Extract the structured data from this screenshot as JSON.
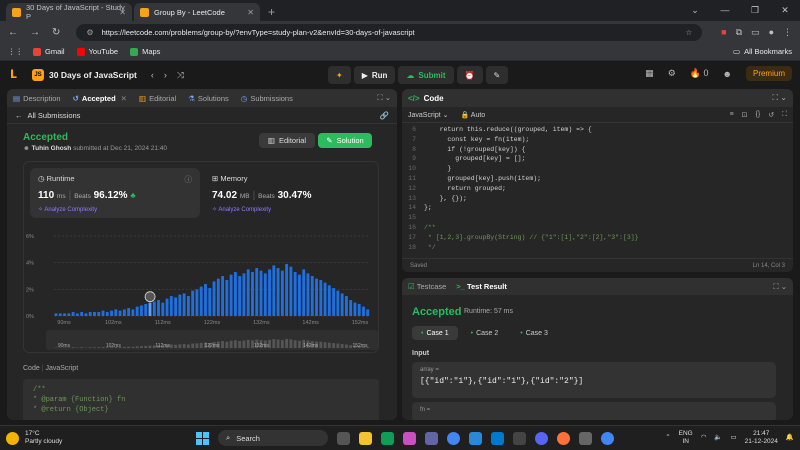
{
  "browser": {
    "tabs": [
      {
        "title": "30 Days of JavaScript - Study P"
      },
      {
        "title": "Group By - LeetCode"
      }
    ],
    "new_tab": "+",
    "url": "https://leetcode.com/problems/group-by/?envType=study-plan-v2&envId=30-days-of-javascript",
    "bookmarks": [
      "Gmail",
      "YouTube",
      "Maps"
    ],
    "all_bookmarks": "All Bookmarks"
  },
  "header": {
    "study_plan": "30 Days of JavaScript",
    "run": "Run",
    "submit": "Submit",
    "streak": "0",
    "premium": "Premium"
  },
  "left": {
    "tabs": [
      "Description",
      "Accepted",
      "Editorial",
      "Solutions",
      "Submissions"
    ],
    "all_submissions": "All Submissions",
    "status": "Accepted",
    "author": "Tuhin Ghosh",
    "submitted": "submitted at Dec 21, 2024 21:40",
    "editorial_btn": "Editorial",
    "solution_btn": "Solution",
    "runtime": {
      "label": "Runtime",
      "value": "110",
      "unit": "ms",
      "beats_label": "Beats",
      "beats": "96.12%",
      "analyze": "Analyze Complexity"
    },
    "memory": {
      "label": "Memory",
      "value": "74.02",
      "unit": "MB",
      "beats_label": "Beats",
      "beats": "30.47%",
      "analyze": "Analyze Complexity"
    },
    "code_header": "Code",
    "code_lang": "JavaScript",
    "code_lines": [
      "/**",
      " * @param {Function} fn",
      " * @return {Object}"
    ]
  },
  "chart_data": {
    "type": "bar",
    "y_ticks": [
      "6%",
      "4%",
      "2%",
      "0%"
    ],
    "ylim": [
      0,
      6
    ],
    "x_ticks": [
      "90ms",
      "102ms",
      "112ms",
      "122ms",
      "132ms",
      "142ms",
      "152ms"
    ],
    "values": [
      0.2,
      0.2,
      0.2,
      0.2,
      0.3,
      0.2,
      0.3,
      0.2,
      0.3,
      0.3,
      0.3,
      0.4,
      0.3,
      0.4,
      0.5,
      0.4,
      0.5,
      0.6,
      0.5,
      0.7,
      0.8,
      0.9,
      1.0,
      1.1,
      1.2,
      1.0,
      1.3,
      1.5,
      1.4,
      1.6,
      1.7,
      1.5,
      1.9,
      2.0,
      2.2,
      2.4,
      2.1,
      2.6,
      2.8,
      3.0,
      2.7,
      3.1,
      3.3,
      3.0,
      3.2,
      3.5,
      3.3,
      3.6,
      3.4,
      3.2,
      3.5,
      3.8,
      3.6,
      3.4,
      3.9,
      3.7,
      3.3,
      3.1,
      3.5,
      3.2,
      3.0,
      2.8,
      2.7,
      2.5,
      2.3,
      2.1,
      1.9,
      1.7,
      1.5,
      1.2,
      1.0,
      0.9,
      0.7,
      0.5
    ],
    "highlight_index": 22,
    "grid": true
  },
  "editor": {
    "title": "Code",
    "language": "JavaScript",
    "mode": "Auto",
    "first_line": 6,
    "lines": [
      "    return this.reduce((grouped, item) => {",
      "      const key = fn(item);",
      "      if (!grouped[key]) {",
      "        grouped[key] = [];",
      "      }",
      "      grouped[key].push(item);",
      "      return grouped;",
      "    }, {});",
      "};",
      "",
      "/**",
      " * [1,2,3].groupBy(String) // {\"1\":[1],\"2\":[2],\"3\":[3]}",
      " */"
    ],
    "saved": "Saved",
    "cursor": "Ln 14, Col 3"
  },
  "testresult": {
    "testcase_tab": "Testcase",
    "result_tab": "Test Result",
    "status": "Accepted",
    "runtime": "Runtime: 57 ms",
    "cases": [
      "Case 1",
      "Case 2",
      "Case 3"
    ],
    "input_label": "Input",
    "input_name": "array =",
    "input_value": "[{\"id\":\"1\"},{\"id\":\"1\"},{\"id\":\"2\"}]",
    "fn_name": "fn ="
  },
  "taskbar": {
    "temp": "17°C",
    "weather": "Partly cloudy",
    "search": "Search",
    "lang1": "ENG",
    "lang2": "IN",
    "time": "21:47",
    "date": "21-12-2024"
  }
}
